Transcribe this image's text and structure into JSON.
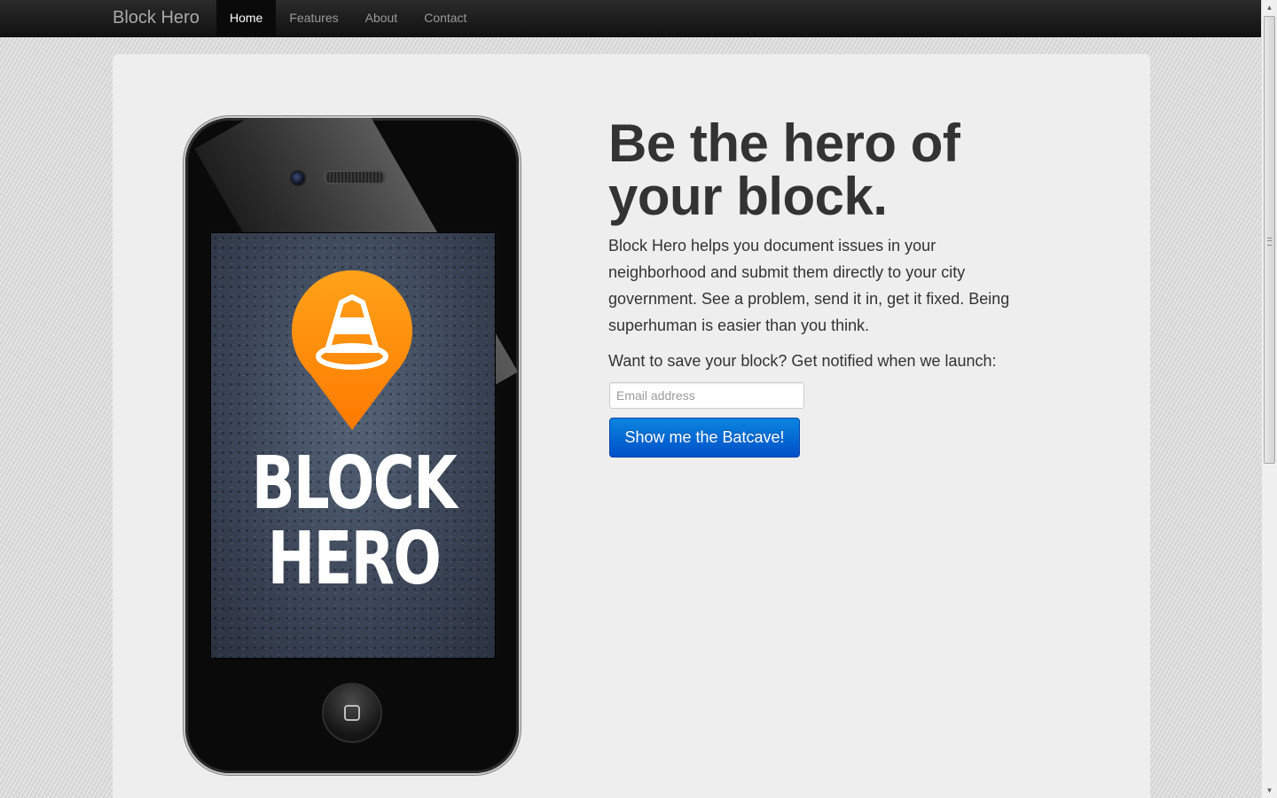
{
  "navbar": {
    "brand": "Block Hero",
    "items": [
      {
        "label": "Home",
        "active": true
      },
      {
        "label": "Features",
        "active": false
      },
      {
        "label": "About",
        "active": false
      },
      {
        "label": "Contact",
        "active": false
      }
    ]
  },
  "hero": {
    "headline_line1": "Be the hero of",
    "headline_line2": "your block.",
    "lead": "Block Hero helps you document issues in your neighborhood and submit them directly to your city government. See a problem, send it in, get it fixed. Being superhuman is easier than you think.",
    "prompt": "Want to save your block? Get notified when we launch:",
    "email_placeholder": "Email address",
    "email_value": "",
    "cta_label": "Show me the Batcave!"
  },
  "phone": {
    "app_logo_line1": "BLOCK",
    "app_logo_line2": "HERO",
    "pin_icon": "traffic-cone-pin-icon"
  },
  "colors": {
    "navbar_bg": "#1b1b1b",
    "hero_bg": "#eeeeee",
    "cta_blue": "#0066d6",
    "pin_orange": "#ff8a00",
    "headline_text": "#333333"
  }
}
